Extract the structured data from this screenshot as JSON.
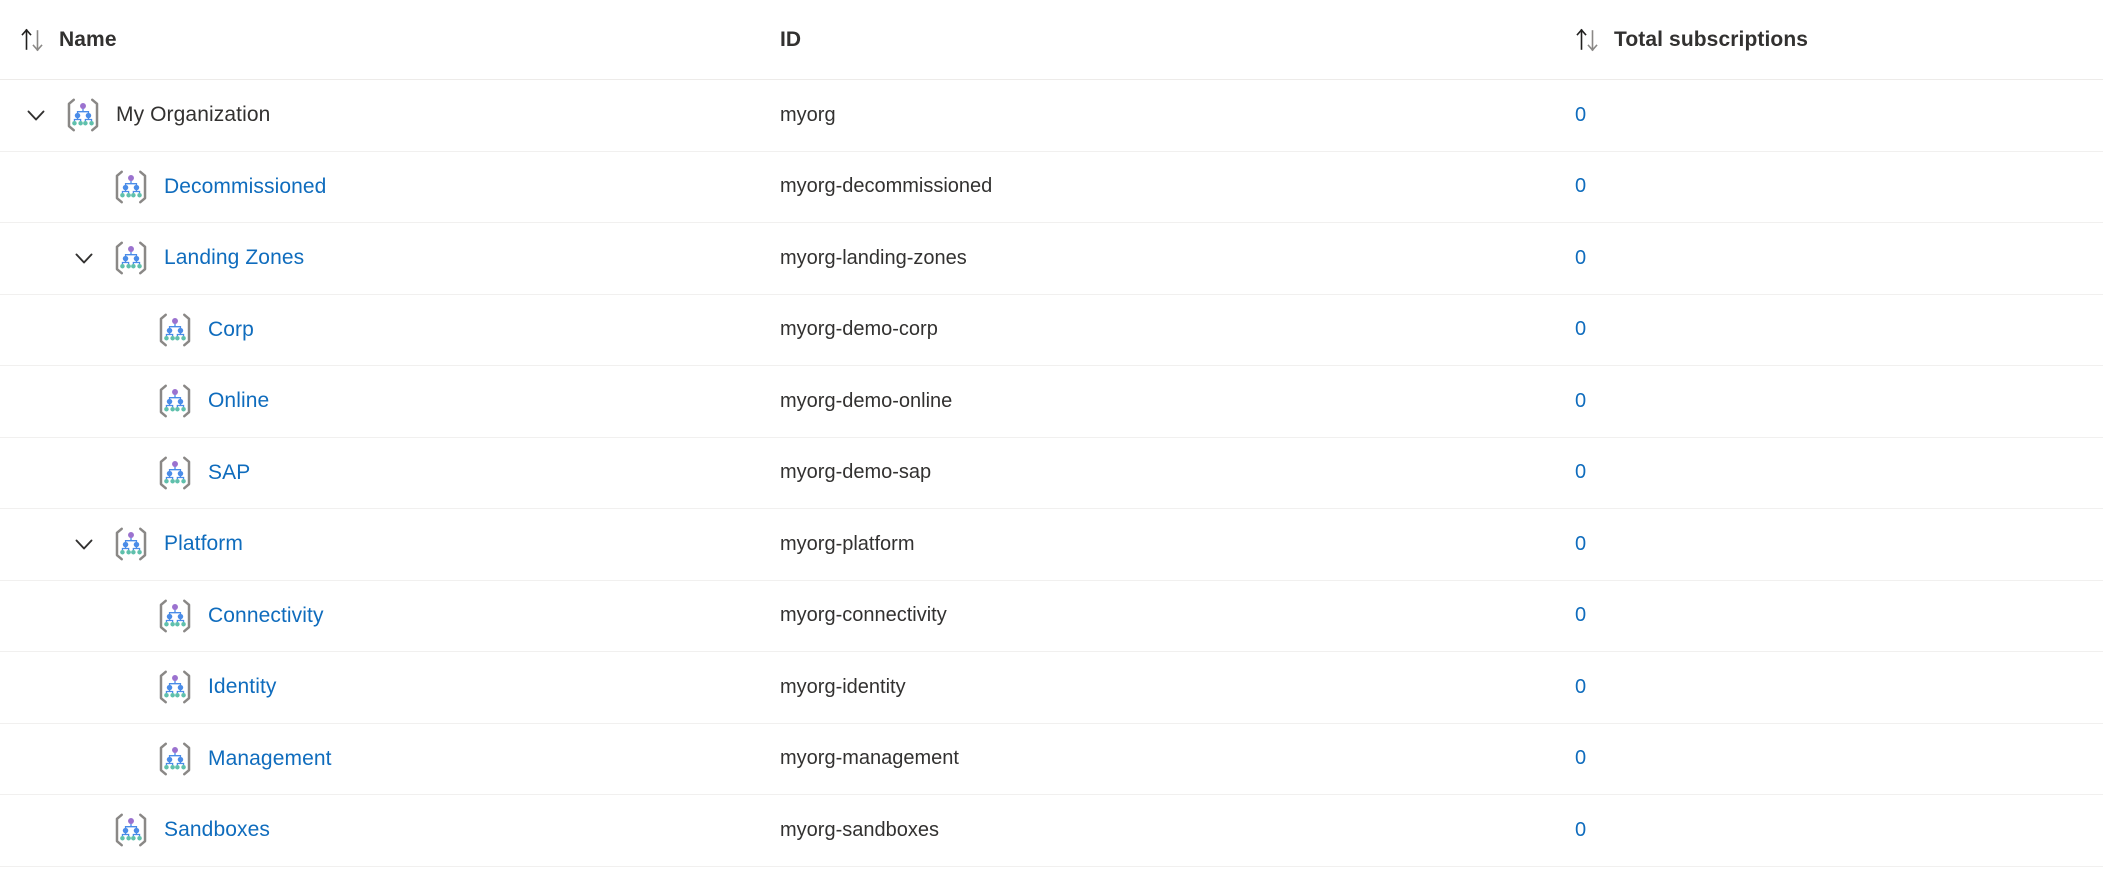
{
  "columns": [
    {
      "key": "name",
      "label": "Name",
      "sort_icon": "sort-updown-icon",
      "sortable": true
    },
    {
      "key": "id",
      "label": "ID",
      "sort_icon": null,
      "sortable": false
    },
    {
      "key": "subs",
      "label": "Total subscriptions",
      "sort_icon": "sort-updown-icon",
      "sortable": true
    }
  ],
  "colors": {
    "link": "#0f6cbd",
    "text": "#323130",
    "row_border": "#f1f0ef",
    "header_border": "#edebe9",
    "icon_bracket": "#8a8886",
    "icon_node_top": "#9b72cf",
    "icon_node_mid": "#4a8ce8",
    "icon_node_leaf": "#5fc0ac"
  },
  "rows": [
    {
      "name": "My Organization",
      "id": "myorg",
      "subs": "0",
      "level": 0,
      "expanded": true,
      "has_children": true,
      "is_link": false,
      "icon": "management-group-icon"
    },
    {
      "name": "Decommissioned",
      "id": "myorg-decommissioned",
      "subs": "0",
      "level": 1,
      "expanded": false,
      "has_children": false,
      "is_link": true,
      "icon": "management-group-icon"
    },
    {
      "name": "Landing Zones",
      "id": "myorg-landing-zones",
      "subs": "0",
      "level": 1,
      "expanded": true,
      "has_children": true,
      "is_link": true,
      "icon": "management-group-icon"
    },
    {
      "name": "Corp",
      "id": "myorg-demo-corp",
      "subs": "0",
      "level": 2,
      "expanded": false,
      "has_children": false,
      "is_link": true,
      "icon": "management-group-icon"
    },
    {
      "name": "Online",
      "id": "myorg-demo-online",
      "subs": "0",
      "level": 2,
      "expanded": false,
      "has_children": false,
      "is_link": true,
      "icon": "management-group-icon"
    },
    {
      "name": "SAP",
      "id": "myorg-demo-sap",
      "subs": "0",
      "level": 2,
      "expanded": false,
      "has_children": false,
      "is_link": true,
      "icon": "management-group-icon"
    },
    {
      "name": "Platform",
      "id": "myorg-platform",
      "subs": "0",
      "level": 1,
      "expanded": true,
      "has_children": true,
      "is_link": true,
      "icon": "management-group-icon"
    },
    {
      "name": "Connectivity",
      "id": "myorg-connectivity",
      "subs": "0",
      "level": 2,
      "expanded": false,
      "has_children": false,
      "is_link": true,
      "icon": "management-group-icon"
    },
    {
      "name": "Identity",
      "id": "myorg-identity",
      "subs": "0",
      "level": 2,
      "expanded": false,
      "has_children": false,
      "is_link": true,
      "icon": "management-group-icon"
    },
    {
      "name": "Management",
      "id": "myorg-management",
      "subs": "0",
      "level": 2,
      "expanded": false,
      "has_children": false,
      "is_link": true,
      "icon": "management-group-icon"
    },
    {
      "name": "Sandboxes",
      "id": "myorg-sandboxes",
      "subs": "0",
      "level": 1,
      "expanded": false,
      "has_children": false,
      "is_link": true,
      "icon": "management-group-icon"
    }
  ]
}
